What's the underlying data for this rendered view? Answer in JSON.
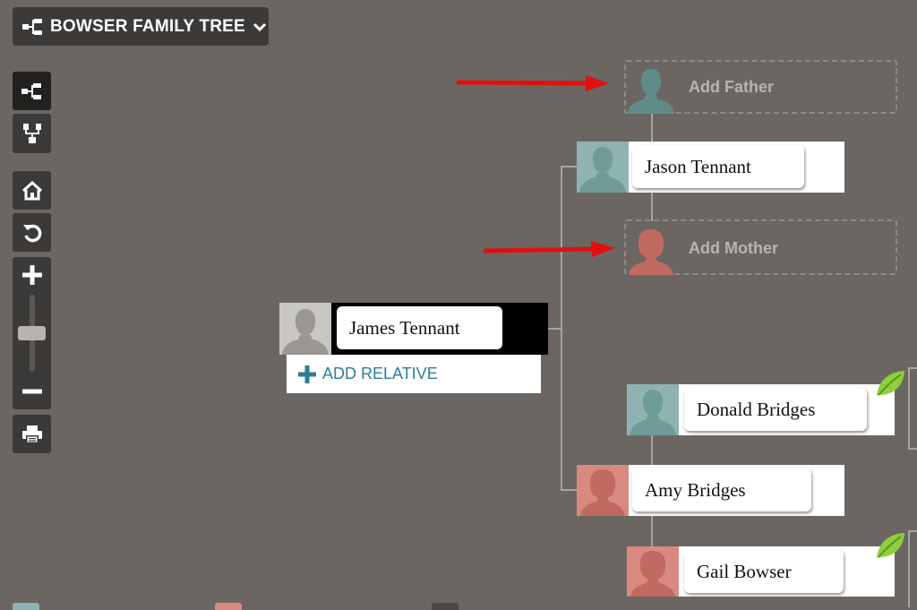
{
  "header": {
    "tree_name": "BOWSER FAMILY TREE"
  },
  "toolbar": {
    "icons": [
      "pedigree-view-icon",
      "descendants-view-icon",
      "home-icon",
      "reset-icon",
      "zoom-in-icon",
      "zoom-out-icon",
      "print-icon"
    ],
    "zoom_level": 0.5
  },
  "tree": {
    "focus_person": {
      "name": "James Tennant",
      "add_relative_label": "ADD RELATIVE"
    },
    "father": {
      "name": "Jason Tennant"
    },
    "paternal_grandfather_placeholder": "Add Father",
    "paternal_grandmother_placeholder": "Add Mother",
    "mother": {
      "name": "Amy Bridges"
    },
    "maternal_grandfather": {
      "name": "Donald Bridges",
      "hint": "leaf-icon"
    },
    "maternal_grandmother": {
      "name": "Gail Bowser",
      "hint": "leaf-icon"
    }
  },
  "colors": {
    "background": "#6b6661",
    "male_avatar": "#8fb3b3",
    "female_avatar": "#d98a80",
    "unknown_avatar": "#c9c7c3",
    "accent": "#2e7d95",
    "annotation_arrow": "#e01010"
  }
}
